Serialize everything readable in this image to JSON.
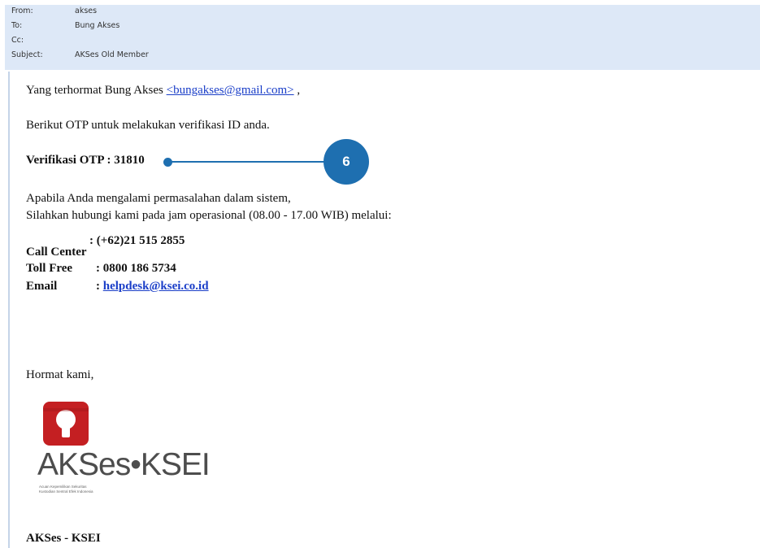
{
  "header": {
    "from_label": "From:",
    "from_value": "akses",
    "to_label": "To:",
    "to_value": "Bung Akses",
    "cc_label": "Cc:",
    "cc_value": "",
    "subject_label": "Subject:",
    "subject_value": "AKSes Old Member"
  },
  "email": {
    "greeting_prefix": "Yang terhormat  Bung Akses ",
    "greeting_email": "<bungakses@gmail.com>",
    "greeting_suffix": " ,",
    "otp_intro": "Berikut OTP untuk melakukan verifikasi ID anda.",
    "otp_label": "Verifikasi OTP : 31810",
    "help_line1": "Apabila Anda mengalami permasalahan dalam sistem,",
    "help_line2": "Silahkan hubungi kami pada jam operasional (08.00 - 17.00 WIB) melalui:",
    "contact_call_label": "Call Center",
    "contact_call_value": ": (+62)21 515 2855",
    "contact_toll_label": "Toll Free",
    "contact_toll_value": ": 0800 186 5734",
    "contact_email_label": "Email",
    "contact_email_sep": ": ",
    "contact_email_value": "helpdesk@ksei.co.id",
    "closing": "Hormat kami,",
    "signature": "AKSes - KSEI"
  },
  "logo": {
    "text": "AKSes•KSEI",
    "tagline1": "Acuan Kepemilikan Sekuritas",
    "tagline2": "Kustodian Sentral Efek Indonesia"
  },
  "annotation": {
    "badge_number": "6"
  },
  "colors": {
    "header_bg": "#dde8f7",
    "link": "#1a3ec8",
    "annotation": "#1e6fb0",
    "logo_red": "#c41f22"
  }
}
